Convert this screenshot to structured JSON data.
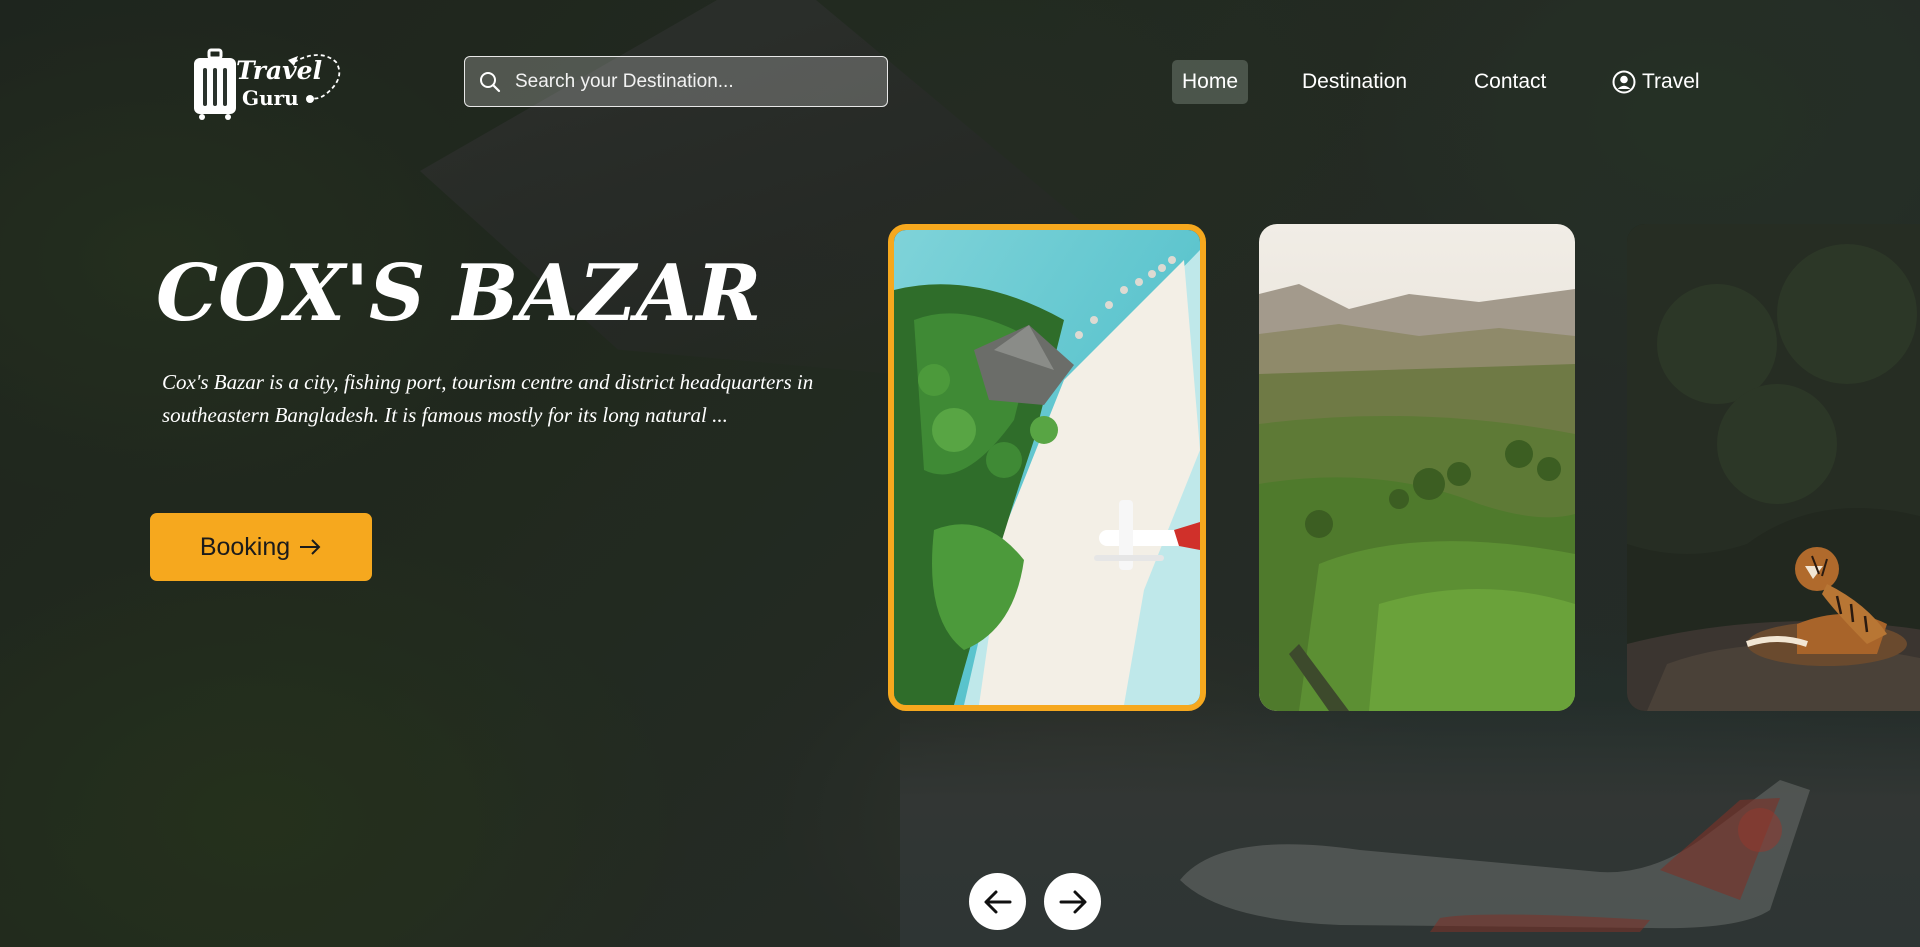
{
  "brand": {
    "logo_line1": "Travel",
    "logo_line2": "Guru",
    "accent_color": "#f6a81e"
  },
  "search": {
    "placeholder": "Search your Destination...",
    "value": ""
  },
  "nav": {
    "items": [
      {
        "label": "Home",
        "active": true
      },
      {
        "label": "Destination",
        "active": false
      },
      {
        "label": "Contact",
        "active": false
      },
      {
        "label": "Travel",
        "active": false,
        "icon": "user-circle-icon"
      }
    ]
  },
  "hero": {
    "title": "COX'S BAZAR",
    "description": "Cox's Bazar is a city, fishing port, tourism centre and district headquarters in southeastern Bangladesh. It is famous mostly for its long natural ...",
    "booking_label": "Booking",
    "booking_icon": "arrow-right-icon"
  },
  "cards": [
    {
      "scene": "aerial beach with palm trees and seaplane",
      "selected": true
    },
    {
      "scene": "green tea hills with mountains",
      "selected": false
    },
    {
      "scene": "tiger resting in dark forest",
      "selected": false
    }
  ],
  "slider": {
    "prev_icon": "arrow-left-icon",
    "next_icon": "arrow-right-icon"
  }
}
